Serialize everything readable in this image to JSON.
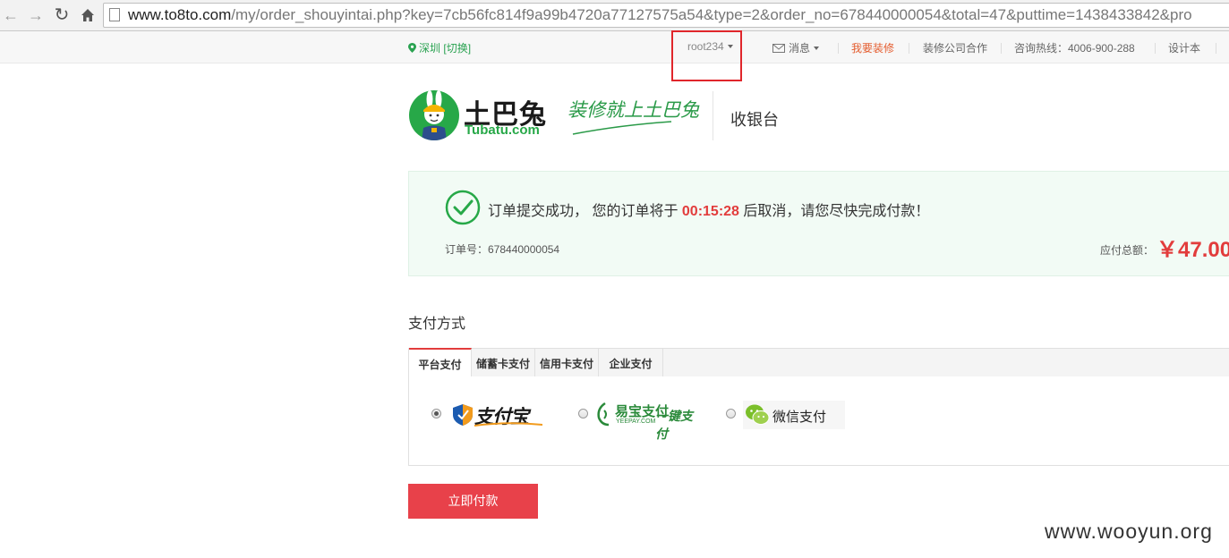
{
  "browser": {
    "url_host": "www.to8to.com",
    "url_rest": "/my/order_shouyintai.php?key=7cb56fc814f9a99b4720a77127575a54&type=2&order_no=678440000054&total=47&puttime=1438433842&pro"
  },
  "topbar": {
    "city": "深圳",
    "switch": "[切换]",
    "user": "root234",
    "messages": "消息",
    "decorate": "我要装修",
    "partner": "装修公司合作",
    "hotline": "咨询热线：4006-900-288",
    "design": "设计本"
  },
  "header": {
    "logo_title": "土巴兔",
    "logo_sub": "Tubatu.com",
    "slogan": "装修就上土巴兔",
    "page_title": "收银台"
  },
  "banner": {
    "msg_prefix": "订单提交成功，  您的订单将于 ",
    "timer": "00:15:28",
    "msg_suffix": " 后取消，请您尽快完成付款！",
    "order_no": "订单号：678440000054",
    "due_label": "应付总额：",
    "due_amount": "￥47.00"
  },
  "payment": {
    "title": "支付方式",
    "tabs": [
      "平台支付",
      "储蓄卡支付",
      "信用卡支付",
      "企业支付"
    ],
    "methods": {
      "alipay": "支付宝",
      "yeepay_name": "易宝支付",
      "yeepay_domain": "YEEPAY.COM",
      "yeepay_onekey": "一键支付",
      "wechat": "微信支付"
    },
    "submit": "立即付款"
  },
  "watermark": "www.wooyun.org",
  "colors": {
    "brand_green": "#27a848",
    "accent_red": "#e23c3c",
    "button_red": "#e8414a",
    "annotation_red": "#e0262b"
  }
}
